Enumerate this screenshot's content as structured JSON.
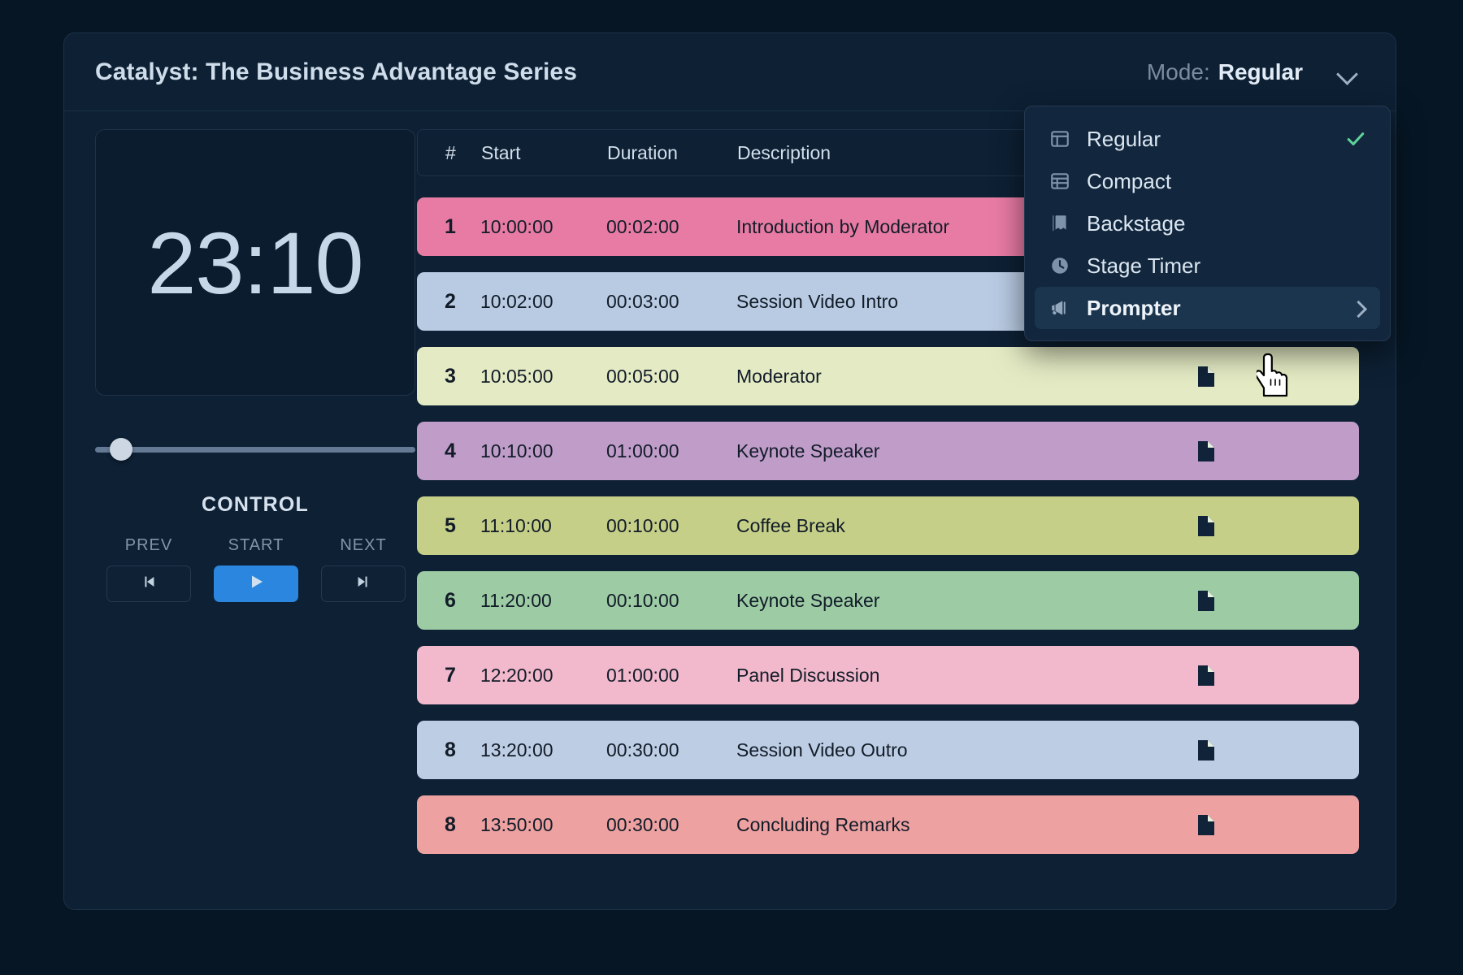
{
  "header": {
    "title": "Catalyst: The Business Advantage Series",
    "mode_label": "Mode:",
    "mode_value": "Regular"
  },
  "mode_menu": {
    "items": [
      {
        "label": "Regular",
        "icon": "layout-icon",
        "checked": true,
        "has_submenu": false,
        "highlighted": false
      },
      {
        "label": "Compact",
        "icon": "table-rows-icon",
        "checked": false,
        "has_submenu": false,
        "highlighted": false
      },
      {
        "label": "Backstage",
        "icon": "book-icon",
        "checked": false,
        "has_submenu": false,
        "highlighted": false
      },
      {
        "label": "Stage Timer",
        "icon": "clock-icon",
        "checked": false,
        "has_submenu": false,
        "highlighted": false
      },
      {
        "label": "Prompter",
        "icon": "megaphone-icon",
        "checked": false,
        "has_submenu": true,
        "highlighted": true
      }
    ],
    "check_color": "#5fd39a"
  },
  "timer": {
    "value": "23:10",
    "slider_percent": 7
  },
  "control": {
    "title": "CONTROL",
    "prev_label": "PREV",
    "start_label": "START",
    "next_label": "NEXT",
    "prev_icon": "skip-back-icon",
    "start_icon": "play-icon",
    "next_icon": "skip-forward-icon",
    "primary_color": "#2a86de"
  },
  "table": {
    "columns": [
      "#",
      "Start",
      "Duration",
      "Description"
    ],
    "rows": [
      {
        "num": "1",
        "start": "10:00:00",
        "duration": "00:02:00",
        "description": "Introduction by Moderator",
        "color": "#e87ba4",
        "doc": true
      },
      {
        "num": "2",
        "start": "10:02:00",
        "duration": "00:03:00",
        "description": "Session Video Intro",
        "color": "#b9cbe3",
        "doc": true
      },
      {
        "num": "3",
        "start": "10:05:00",
        "duration": "00:05:00",
        "description": "Moderator",
        "color": "#e4ebc4",
        "doc": true
      },
      {
        "num": "4",
        "start": "10:10:00",
        "duration": "01:00:00",
        "description": "Keynote Speaker",
        "color": "#c09cc9",
        "doc": true
      },
      {
        "num": "5",
        "start": "11:10:00",
        "duration": "00:10:00",
        "description": "Coffee Break",
        "color": "#c5cf88",
        "doc": true
      },
      {
        "num": "6",
        "start": "11:20:00",
        "duration": "00:10:00",
        "description": "Keynote Speaker",
        "color": "#9ccba4",
        "doc": true
      },
      {
        "num": "7",
        "start": "12:20:00",
        "duration": "01:00:00",
        "description": "Panel Discussion",
        "color": "#f2b8cb",
        "doc": true
      },
      {
        "num": "8",
        "start": "13:20:00",
        "duration": "00:30:00",
        "description": "Session Video Outro",
        "color": "#bdcde4",
        "doc": true
      },
      {
        "num": "8",
        "start": "13:50:00",
        "duration": "00:30:00",
        "description": "Concluding Remarks",
        "color": "#eda1a1",
        "doc": true
      }
    ]
  }
}
